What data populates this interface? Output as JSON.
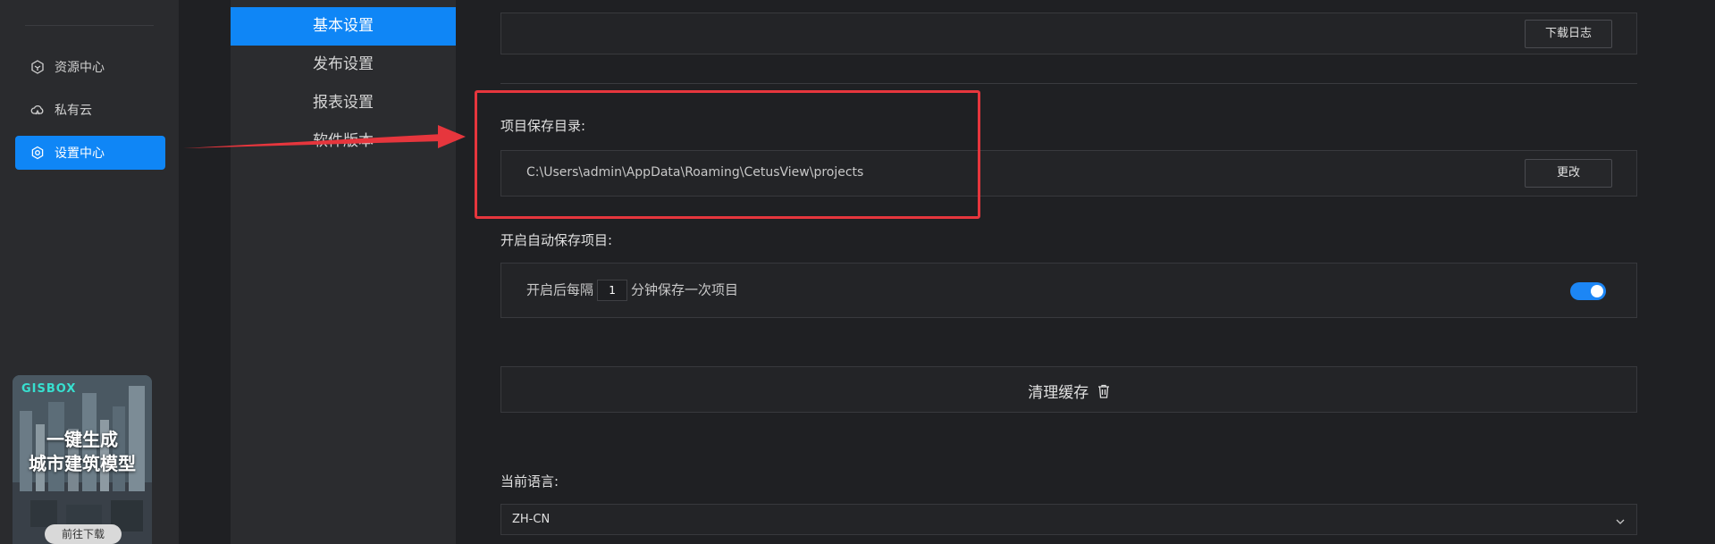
{
  "sidebar": {
    "items": [
      {
        "label": "资源中心",
        "icon": "cube-icon"
      },
      {
        "label": "私有云",
        "icon": "cloud-icon"
      },
      {
        "label": "设置中心",
        "icon": "gear-icon"
      }
    ],
    "active_index": 2
  },
  "promo": {
    "brand": "GISBOX",
    "line1": "一键生成",
    "line2": "城市建筑模型",
    "button": "前往下载"
  },
  "settings_nav": {
    "items": [
      "基本设置",
      "发布设置",
      "报表设置",
      "软件版本"
    ],
    "active_index": 0
  },
  "main": {
    "log_button": "下载日志",
    "project_dir_label": "项目保存目录:",
    "project_dir_path": "C:\\Users\\admin\\AppData\\Roaming\\CetusView\\projects",
    "change_button": "更改",
    "autosave_label": "开启自动保存项目:",
    "autosave_prefix": "开启后每隔",
    "autosave_interval": "1",
    "autosave_suffix": "分钟保存一次项目",
    "autosave_enabled": true,
    "clear_cache_button": "清理缓存",
    "language_label": "当前语言:",
    "language_value": "ZH-CN"
  },
  "colors": {
    "accent": "#0f86f6",
    "annotation": "#e6363d",
    "background": "#1f2023"
  }
}
